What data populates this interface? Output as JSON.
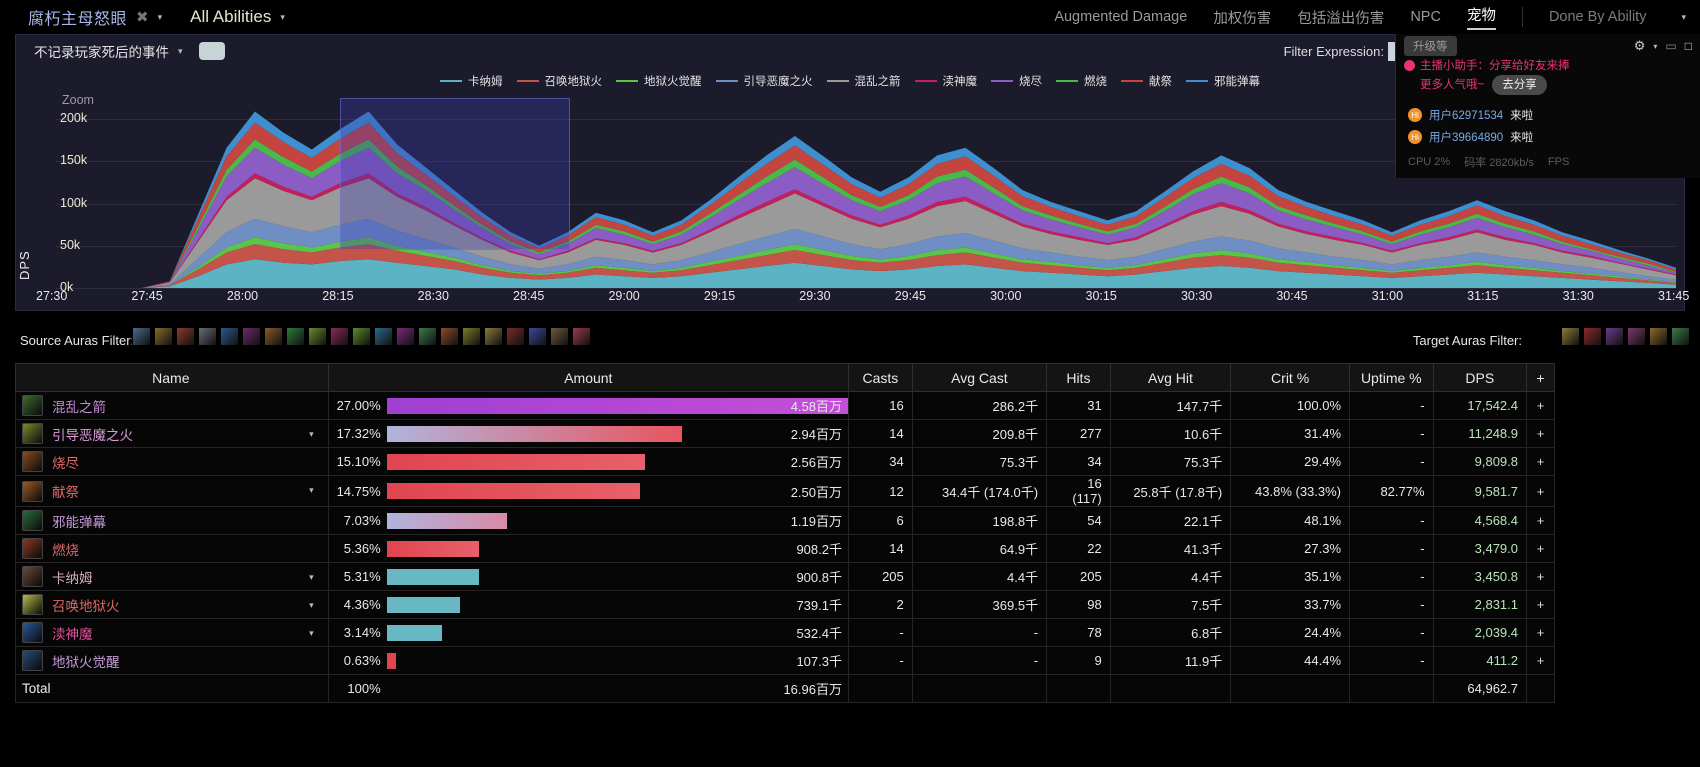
{
  "topbar": {
    "fight_name": "腐朽主母怒眼",
    "x_icon": "✖",
    "caret": "▾",
    "all_abilities": "All Abilities",
    "all_abilities_caret": "▾",
    "nav": [
      {
        "label": "Augmented Damage",
        "active": false
      },
      {
        "label": "加权伤害",
        "active": false
      },
      {
        "label": "包括溢出伤害",
        "active": false
      },
      {
        "label": "NPC",
        "active": false
      },
      {
        "label": "宠物",
        "active": true
      }
    ],
    "right_dropdown": "Done By Ability",
    "right_dropdown_caret": "▾"
  },
  "chart_toolbar": {
    "filter_label": "不记录玩家死后的事件",
    "filter_caret": "▾",
    "filter_expression_label": "Filter Expression:",
    "filter_expression_value": ""
  },
  "overlay": {
    "upgrade_label": "升级等",
    "gear_icon": "⚙",
    "gear_caret": "▾",
    "screen_icon": "▭",
    "square_icon": "□",
    "banner_line1": "主播小助手：分享给好友来捧",
    "banner_line2": "更多人气哦~",
    "share_button": "去分享",
    "messages": [
      {
        "badge": "Hi",
        "user": "用户62971534",
        "action": "来啦"
      },
      {
        "badge": "Hi",
        "user": "用户39664890",
        "action": "来啦"
      }
    ],
    "status_cpu": "CPU 2%",
    "status_bitrate": "码率 2820kb/s",
    "status_fps": "FPS"
  },
  "chart_data": {
    "type": "area",
    "title": "",
    "xlabel": "",
    "ylabel": "DPS",
    "zoom_label": "Zoom",
    "ylim": [
      0,
      225000
    ],
    "yticks": [
      "0k",
      "50k",
      "100k",
      "150k",
      "200k"
    ],
    "ytick_values": [
      0,
      50000,
      100000,
      150000,
      200000
    ],
    "xticks": [
      "27:30",
      "27:45",
      "28:00",
      "28:15",
      "28:30",
      "28:45",
      "29:00",
      "29:15",
      "29:30",
      "29:45",
      "30:00",
      "30:15",
      "30:30",
      "30:45",
      "31:00",
      "31:15",
      "31:30",
      "31:45"
    ],
    "grid": true,
    "legend_position": "top",
    "selection": {
      "start": "28:15",
      "end": "28:50"
    },
    "series": [
      {
        "name": "卡纳姆",
        "color": "#5cb3c4",
        "values": [
          0,
          0,
          0,
          0,
          2,
          14,
          28,
          34,
          30,
          28,
          32,
          34,
          30,
          26,
          22,
          16,
          12,
          10,
          12,
          16,
          14,
          12,
          14,
          18,
          22,
          26,
          30,
          26,
          22,
          20,
          22,
          26,
          28,
          24,
          20,
          18,
          16,
          14,
          16,
          20,
          24,
          26,
          24,
          20,
          18,
          16,
          14,
          12,
          14,
          16,
          18,
          16,
          14,
          12,
          10,
          8,
          6,
          4
        ]
      },
      {
        "name": "召唤地狱火",
        "color": "#c4534a",
        "values": [
          0,
          0,
          0,
          0,
          1,
          8,
          14,
          18,
          16,
          14,
          16,
          18,
          14,
          12,
          10,
          8,
          6,
          5,
          6,
          8,
          7,
          6,
          7,
          9,
          11,
          13,
          15,
          13,
          11,
          10,
          11,
          13,
          14,
          12,
          10,
          9,
          8,
          7,
          8,
          10,
          12,
          13,
          12,
          10,
          9,
          8,
          7,
          6,
          7,
          8,
          9,
          8,
          7,
          6,
          5,
          4,
          3,
          2
        ]
      },
      {
        "name": "地狱火觉醒",
        "color": "#5cc44a",
        "values": [
          0,
          0,
          0,
          0,
          0,
          3,
          6,
          8,
          7,
          6,
          7,
          8,
          6,
          5,
          4,
          3,
          2,
          2,
          2,
          3,
          3,
          2,
          3,
          4,
          5,
          6,
          7,
          6,
          5,
          4,
          5,
          6,
          6,
          5,
          4,
          4,
          3,
          3,
          3,
          4,
          5,
          6,
          5,
          4,
          4,
          3,
          3,
          2,
          3,
          3,
          4,
          3,
          3,
          2,
          2,
          2,
          1,
          1
        ]
      },
      {
        "name": "引导恶魔之火",
        "color": "#6f8fc4",
        "values": [
          0,
          0,
          0,
          0,
          1,
          10,
          18,
          22,
          20,
          18,
          20,
          22,
          18,
          15,
          12,
          10,
          8,
          6,
          8,
          10,
          9,
          8,
          9,
          11,
          14,
          16,
          18,
          16,
          14,
          12,
          14,
          16,
          17,
          15,
          13,
          11,
          10,
          9,
          10,
          12,
          14,
          16,
          15,
          13,
          11,
          10,
          9,
          8,
          9,
          10,
          11,
          10,
          9,
          8,
          7,
          5,
          4,
          3
        ]
      },
      {
        "name": "混乱之箭",
        "color": "#9a9a9a",
        "values": [
          0,
          0,
          0,
          0,
          2,
          20,
          38,
          48,
          42,
          38,
          44,
          48,
          40,
          34,
          26,
          20,
          14,
          10,
          14,
          20,
          18,
          14,
          18,
          24,
          30,
          36,
          42,
          36,
          30,
          26,
          30,
          36,
          38,
          32,
          26,
          22,
          20,
          18,
          20,
          26,
          32,
          36,
          32,
          26,
          22,
          20,
          18,
          14,
          18,
          20,
          24,
          20,
          18,
          14,
          12,
          10,
          8,
          5
        ]
      },
      {
        "name": "渎神魔",
        "color": "#c41f5a",
        "values": [
          0,
          0,
          0,
          0,
          0,
          2,
          4,
          6,
          5,
          4,
          5,
          6,
          4,
          4,
          3,
          2,
          2,
          1,
          2,
          2,
          2,
          2,
          2,
          3,
          4,
          5,
          5,
          4,
          4,
          3,
          4,
          5,
          5,
          4,
          3,
          3,
          3,
          2,
          3,
          3,
          4,
          5,
          4,
          3,
          3,
          3,
          2,
          2,
          2,
          3,
          3,
          3,
          2,
          2,
          2,
          1,
          1,
          1
        ]
      },
      {
        "name": "烧尽",
        "color": "#8b5cc4",
        "values": [
          0,
          0,
          0,
          0,
          1,
          12,
          24,
          30,
          26,
          22,
          26,
          30,
          24,
          20,
          16,
          12,
          8,
          6,
          8,
          12,
          10,
          8,
          10,
          14,
          18,
          22,
          26,
          22,
          18,
          16,
          18,
          22,
          24,
          20,
          16,
          14,
          12,
          10,
          12,
          16,
          20,
          22,
          20,
          16,
          14,
          12,
          10,
          8,
          10,
          12,
          14,
          12,
          10,
          8,
          6,
          5,
          4,
          2
        ]
      },
      {
        "name": "燃烧",
        "color": "#4ab84a",
        "values": [
          0,
          0,
          0,
          0,
          0,
          4,
          8,
          10,
          9,
          8,
          9,
          10,
          8,
          6,
          5,
          4,
          3,
          2,
          3,
          4,
          4,
          3,
          4,
          5,
          6,
          8,
          9,
          8,
          6,
          5,
          6,
          8,
          8,
          7,
          5,
          5,
          4,
          4,
          4,
          5,
          6,
          8,
          7,
          5,
          5,
          4,
          4,
          3,
          4,
          4,
          5,
          4,
          4,
          3,
          2,
          2,
          2,
          1
        ]
      },
      {
        "name": "献祭",
        "color": "#c4453f",
        "values": [
          0,
          0,
          0,
          0,
          1,
          9,
          16,
          20,
          18,
          16,
          18,
          20,
          16,
          13,
          11,
          9,
          7,
          5,
          7,
          9,
          8,
          7,
          8,
          10,
          13,
          15,
          17,
          15,
          13,
          11,
          13,
          15,
          16,
          14,
          12,
          10,
          9,
          8,
          9,
          11,
          13,
          15,
          14,
          12,
          10,
          9,
          8,
          7,
          8,
          9,
          10,
          9,
          8,
          7,
          6,
          5,
          4,
          3
        ]
      },
      {
        "name": "邪能弹幕",
        "color": "#3e8fd0",
        "values": [
          0,
          0,
          0,
          0,
          0,
          5,
          10,
          13,
          11,
          10,
          11,
          13,
          10,
          8,
          7,
          5,
          4,
          3,
          4,
          5,
          5,
          4,
          5,
          6,
          8,
          10,
          11,
          10,
          8,
          7,
          8,
          10,
          10,
          9,
          7,
          6,
          6,
          5,
          6,
          7,
          8,
          10,
          9,
          7,
          6,
          6,
          5,
          4,
          5,
          6,
          6,
          6,
          5,
          4,
          4,
          3,
          2,
          2
        ]
      }
    ]
  },
  "source_auras": {
    "label": "Source Auras Filter:",
    "icons": [
      "aura-1",
      "aura-2",
      "aura-3",
      "aura-4",
      "aura-5",
      "aura-6",
      "aura-7",
      "aura-8",
      "aura-9",
      "aura-10",
      "aura-11",
      "aura-12",
      "aura-13",
      "aura-14",
      "aura-15",
      "aura-16",
      "aura-17",
      "aura-18",
      "aura-19",
      "aura-20",
      "aura-21"
    ],
    "colors": [
      "#4a6a8a",
      "#8a6a2a",
      "#8a3a2a",
      "#6a6a7a",
      "#2a5a8a",
      "#6a2a6a",
      "#8a5a2a",
      "#2a7a3a",
      "#6a8a2a",
      "#8a2a5a",
      "#5a8a2a",
      "#2a6a8a",
      "#7a2a7a",
      "#3a7a4a",
      "#8a4a2a",
      "#7a7a2a",
      "#8a7a3a",
      "#7a2a2a",
      "#3a4a9a",
      "#6a5a3a",
      "#9a3a4a"
    ]
  },
  "target_auras": {
    "label": "Target Auras Filter:",
    "icons": [
      "taura-1",
      "taura-2",
      "taura-3",
      "taura-4",
      "taura-5",
      "taura-6"
    ],
    "colors": [
      "#8a7a3a",
      "#8a2a2a",
      "#6a3a8a",
      "#7a3a6a",
      "#8a6a2a",
      "#3a7a4a"
    ]
  },
  "table": {
    "headers": [
      "Name",
      "Amount",
      "Casts",
      "Avg Cast",
      "Hits",
      "Avg Hit",
      "Crit %",
      "Uptime %",
      "DPS",
      "+"
    ],
    "rows": [
      {
        "icon_color": "#3f6a2f",
        "name": "混乱之箭",
        "name_color": "#c48ad8",
        "expandable": false,
        "pct": "27.00%",
        "bar_pct": 100,
        "bar_color": "linear-gradient(90deg,#a13fd0,#c44fd8)",
        "amount": "4.58百万",
        "casts": "16",
        "avg_cast": "286.2千",
        "hits": "31",
        "avg_hit": "147.7千",
        "crit": "100.0%",
        "uptime": "-",
        "dps": "17,542.4",
        "plus": "+"
      },
      {
        "icon_color": "#7a8a2f",
        "name": "引导恶魔之火",
        "name_color": "#d99ad8",
        "expandable": true,
        "pct": "17.32%",
        "bar_pct": 64,
        "bar_color": "linear-gradient(90deg,#b0b4dc,#e8555f)",
        "amount": "2.94百万",
        "casts": "14",
        "avg_cast": "209.8千",
        "hits": "277",
        "avg_hit": "10.6千",
        "crit": "31.4%",
        "uptime": "-",
        "dps": "11,248.9",
        "plus": "+"
      },
      {
        "icon_color": "#8a4a22",
        "name": "烧尽",
        "name_color": "#e06868",
        "expandable": false,
        "pct": "15.10%",
        "bar_pct": 56,
        "bar_color": "linear-gradient(90deg,#e0454f,#e8606a)",
        "amount": "2.56百万",
        "casts": "34",
        "avg_cast": "75.3千",
        "hits": "34",
        "avg_hit": "75.3千",
        "crit": "29.4%",
        "uptime": "-",
        "dps": "9,809.8",
        "plus": "+"
      },
      {
        "icon_color": "#9a5a22",
        "name": "献祭",
        "name_color": "#e06868",
        "expandable": true,
        "pct": "14.75%",
        "bar_pct": 55,
        "bar_color": "linear-gradient(90deg,#e0454f,#e8606a)",
        "amount": "2.50百万",
        "casts": "12",
        "avg_cast": "34.4千 (174.0千)",
        "hits": "16 (117)",
        "avg_hit": "25.8千 (17.8千)",
        "crit": "43.8% (33.3%)",
        "uptime": "82.77%",
        "dps": "9,581.7",
        "plus": "+"
      },
      {
        "icon_color": "#2f6a3a",
        "name": "邪能弹幕",
        "name_color": "#c49ad8",
        "expandable": false,
        "pct": "7.03%",
        "bar_pct": 26,
        "bar_color": "linear-gradient(90deg,#b0b4dc,#d98aa8)",
        "amount": "1.19百万",
        "casts": "6",
        "avg_cast": "198.8千",
        "hits": "54",
        "avg_hit": "22.1千",
        "crit": "48.1%",
        "uptime": "-",
        "dps": "4,568.4",
        "plus": "+"
      },
      {
        "icon_color": "#8a3a22",
        "name": "燃烧",
        "name_color": "#e06868",
        "expandable": false,
        "pct": "5.36%",
        "bar_pct": 20,
        "bar_color": "linear-gradient(90deg,#e0454f,#e8606a)",
        "amount": "908.2千",
        "casts": "14",
        "avg_cast": "64.9千",
        "hits": "22",
        "avg_hit": "41.3千",
        "crit": "27.3%",
        "uptime": "-",
        "dps": "3,479.0",
        "plus": "+"
      },
      {
        "icon_color": "#6a4a3a",
        "name": "卡纳姆",
        "name_color": "#d8a8c4",
        "expandable": true,
        "pct": "5.31%",
        "bar_pct": 20,
        "bar_color": "#68b8c4",
        "amount": "900.8千",
        "casts": "205",
        "avg_cast": "4.4千",
        "hits": "205",
        "avg_hit": "4.4千",
        "crit": "35.1%",
        "uptime": "-",
        "dps": "3,450.8",
        "plus": "+"
      },
      {
        "icon_color": "#b8b84a",
        "name": "召唤地狱火",
        "name_color": "#e06868",
        "expandable": true,
        "pct": "4.36%",
        "bar_pct": 16,
        "bar_color": "#68b8c4",
        "amount": "739.1千",
        "casts": "2",
        "avg_cast": "369.5千",
        "hits": "98",
        "avg_hit": "7.5千",
        "crit": "33.7%",
        "uptime": "-",
        "dps": "2,831.1",
        "plus": "+"
      },
      {
        "icon_color": "#2a5a9a",
        "name": "渎神魔",
        "name_color": "#e0559a",
        "expandable": true,
        "pct": "3.14%",
        "bar_pct": 12,
        "bar_color": "#68b8c4",
        "amount": "532.4千",
        "casts": "-",
        "avg_cast": "-",
        "hits": "78",
        "avg_hit": "6.8千",
        "crit": "24.4%",
        "uptime": "-",
        "dps": "2,039.4",
        "plus": "+"
      },
      {
        "icon_color": "#2a4a7a",
        "name": "地狱火觉醒",
        "name_color": "#c49ad8",
        "expandable": false,
        "pct": "0.63%",
        "bar_pct": 2,
        "bar_color": "#e0454f",
        "amount": "107.3千",
        "casts": "-",
        "avg_cast": "-",
        "hits": "9",
        "avg_hit": "11.9千",
        "crit": "44.4%",
        "uptime": "-",
        "dps": "411.2",
        "plus": "+"
      }
    ],
    "total": {
      "label": "Total",
      "pct": "100%",
      "amount": "16.96百万",
      "dps": "64,962.7"
    }
  }
}
